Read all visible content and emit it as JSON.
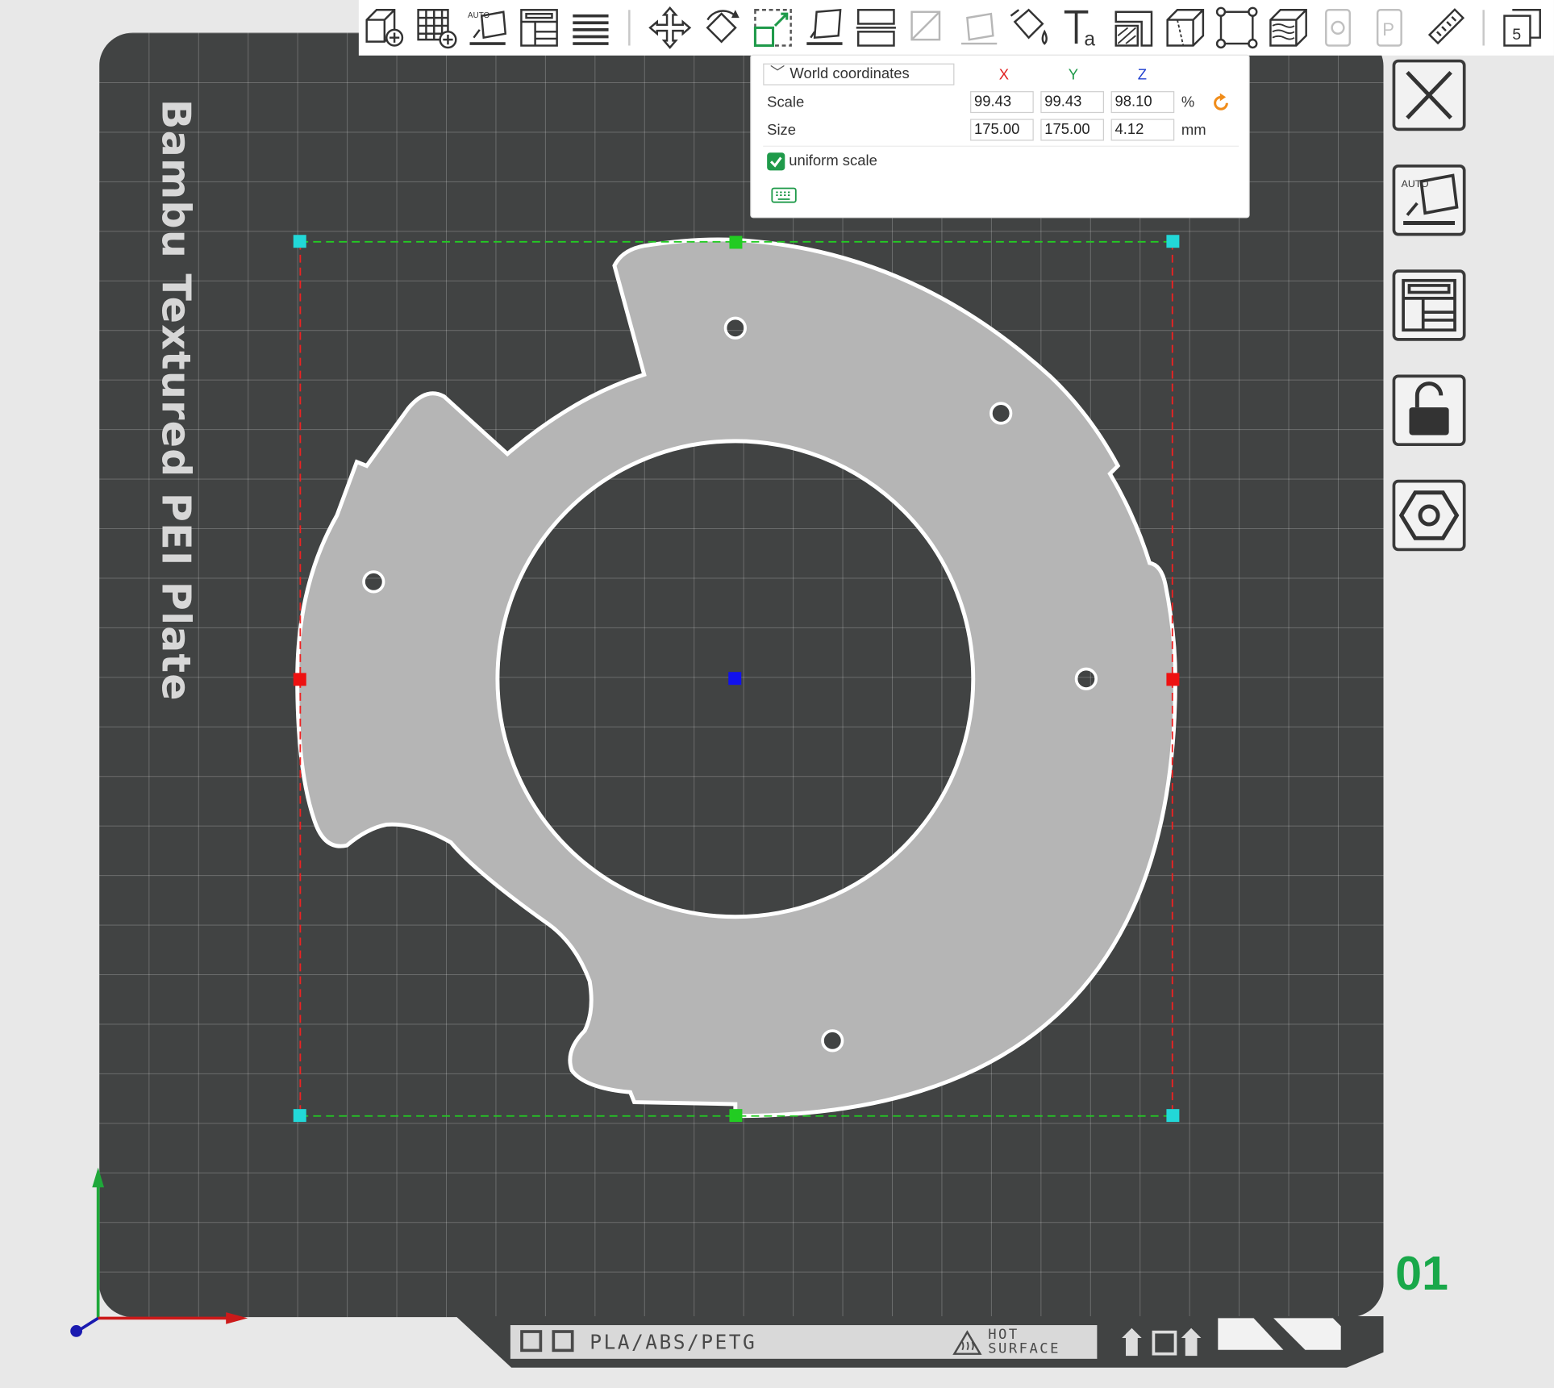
{
  "plate": {
    "label": "Bambu Textured PEI Plate",
    "number": "01",
    "filament": "PLA/ABS/PETG",
    "hot_surface_line1": "HOT",
    "hot_surface_line2": "SURFACE"
  },
  "toolbar": {
    "items": [
      "add-part-icon",
      "add-plate-icon",
      "auto-orient-icon",
      "arrange-icon",
      "layers-icon",
      "move-icon",
      "rotate-icon",
      "scale-icon",
      "lay-on-face-icon",
      "cut-icon",
      "support-paint-icon",
      "seam-paint-icon",
      "color-paint-icon",
      "text-icon",
      "emboss-icon",
      "measure-icon",
      "variable-layer-icon",
      "brim-ears-icon",
      "mesh-boolean-icon",
      "assembly-icon",
      "ruler-icon",
      "split-view-icon"
    ]
  },
  "scale_panel": {
    "coordinate_system": "World coordinates",
    "axes": {
      "x": "X",
      "y": "Y",
      "z": "Z"
    },
    "axis_colors": {
      "x": "#e02020",
      "y": "#1f9a4a",
      "z": "#2040d0"
    },
    "scale": {
      "label": "Scale",
      "x": "99.43",
      "y": "99.43",
      "z": "98.10",
      "unit": "%"
    },
    "size": {
      "label": "Size",
      "x": "175.00",
      "y": "175.00",
      "z": "4.12",
      "unit": "mm"
    },
    "uniform_scale": {
      "label": "uniform scale",
      "checked": true
    }
  },
  "sidebar": {
    "buttons": [
      "close-icon",
      "auto-orient-icon",
      "arrange-icon",
      "unlock-icon",
      "settings-hexagon-icon"
    ]
  },
  "colors": {
    "plate": "#414343",
    "part": "#b5b5b5",
    "accent": "#19a84a"
  }
}
